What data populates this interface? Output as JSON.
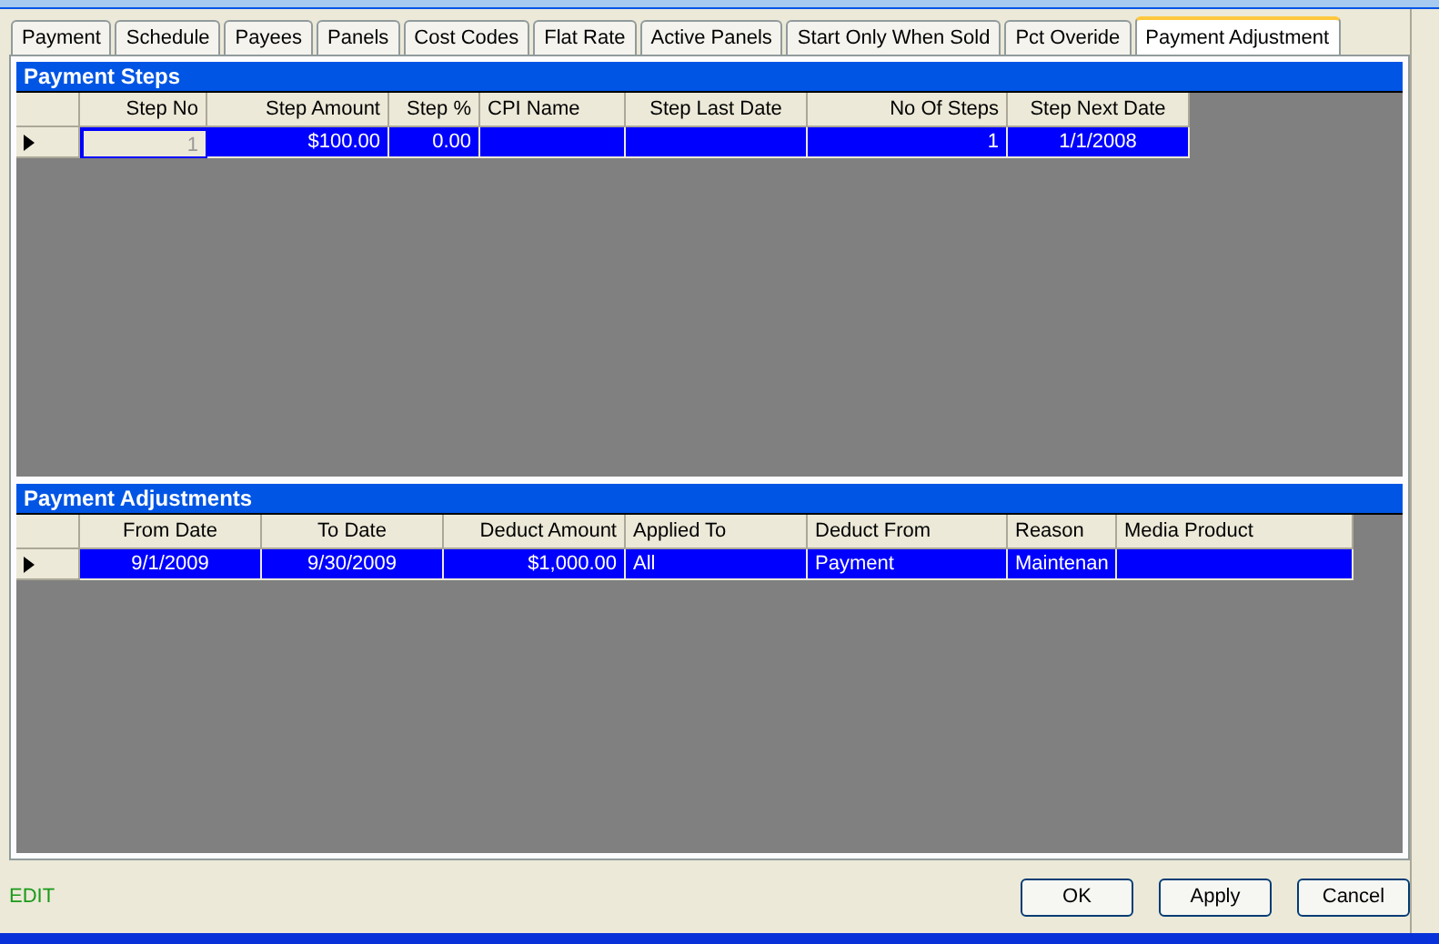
{
  "tabs": [
    {
      "label": "Payment",
      "selected": false
    },
    {
      "label": "Schedule",
      "selected": false
    },
    {
      "label": "Payees",
      "selected": false
    },
    {
      "label": "Panels",
      "selected": false
    },
    {
      "label": "Cost Codes",
      "selected": false
    },
    {
      "label": "Flat Rate",
      "selected": false
    },
    {
      "label": "Active Panels",
      "selected": false
    },
    {
      "label": "Start Only When Sold",
      "selected": false
    },
    {
      "label": "Pct Overide",
      "selected": false
    },
    {
      "label": "Payment Adjustment",
      "selected": true
    }
  ],
  "grids": [
    {
      "title": "Payment Steps",
      "columns": [
        "Step No",
        "Step Amount",
        "Step %",
        "CPI Name",
        "Step Last Date",
        "No Of Steps",
        "Step Next Date"
      ],
      "rows": [
        {
          "selected": true,
          "cells": [
            {
              "text": "1",
              "focused": true
            },
            {
              "text": "$100.00",
              "focused": false
            },
            {
              "text": "0.00",
              "focused": false
            },
            {
              "text": "",
              "focused": false
            },
            {
              "text": "",
              "focused": false
            },
            {
              "text": "1",
              "focused": false
            },
            {
              "text": "1/1/2008",
              "focused": false
            }
          ]
        }
      ]
    },
    {
      "title": "Payment Adjustments",
      "columns": [
        "From Date",
        "To Date",
        "Deduct Amount",
        "Applied To",
        "Deduct From",
        "Reason",
        "Media Product"
      ],
      "rows": [
        {
          "selected": true,
          "cells": [
            {
              "text": "9/1/2009",
              "focused": false
            },
            {
              "text": "9/30/2009",
              "focused": false
            },
            {
              "text": "$1,000.00",
              "focused": false
            },
            {
              "text": "All",
              "focused": false
            },
            {
              "text": "Payment",
              "focused": false
            },
            {
              "text": "Maintenan",
              "focused": false
            },
            {
              "text": "",
              "focused": false
            }
          ]
        }
      ]
    }
  ],
  "status": "EDIT",
  "buttons": [
    "OK",
    "Apply",
    "Cancel"
  ]
}
